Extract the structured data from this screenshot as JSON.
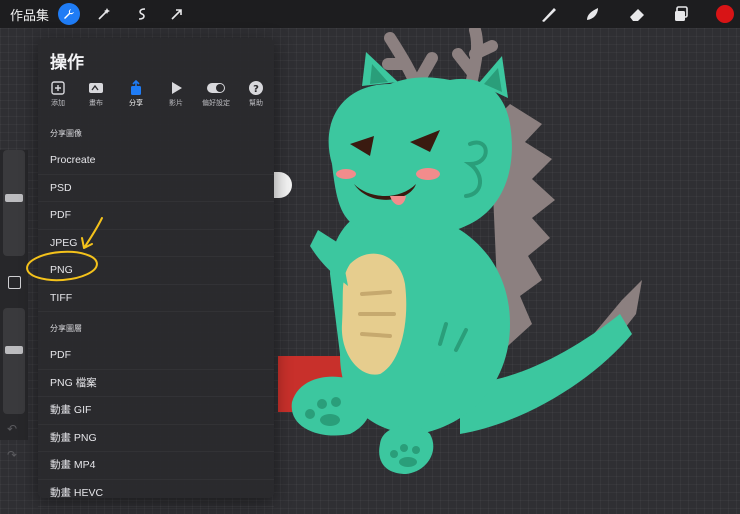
{
  "topbar": {
    "gallery_label": "作品集",
    "tools": [
      "wrench-icon",
      "magic-wand-icon",
      "selection-icon",
      "transform-arrow-icon"
    ],
    "right_tools": [
      "brush-icon",
      "smudge-icon",
      "eraser-icon",
      "layers-icon"
    ],
    "active_color": "#d81416"
  },
  "panel": {
    "title": "操作",
    "tabs": [
      {
        "label": "添加",
        "icon": "add-icon"
      },
      {
        "label": "畫布",
        "icon": "canvas-icon"
      },
      {
        "label": "分享",
        "icon": "share-icon",
        "active": true
      },
      {
        "label": "影片",
        "icon": "video-play-icon"
      },
      {
        "label": "偏好設定",
        "icon": "toggle-icon"
      },
      {
        "label": "幫助",
        "icon": "help-icon"
      }
    ],
    "share_image_header": "分享圖像",
    "share_image_items": [
      "Procreate",
      "PSD",
      "PDF",
      "JPEG",
      "PNG",
      "TIFF"
    ],
    "share_layers_header": "分享圖層",
    "share_layers_items": [
      "PDF",
      "PNG 檔案",
      "動畫 GIF",
      "動畫 PNG",
      "動畫 MP4",
      "動畫 HEVC"
    ]
  },
  "colors": {
    "accent": "#1f7cf5",
    "dragon_body": "#3cc79f",
    "dragon_belly": "#e6cd8e",
    "dragon_spikes": "#8c8080",
    "annotation": "#f4c21b"
  }
}
